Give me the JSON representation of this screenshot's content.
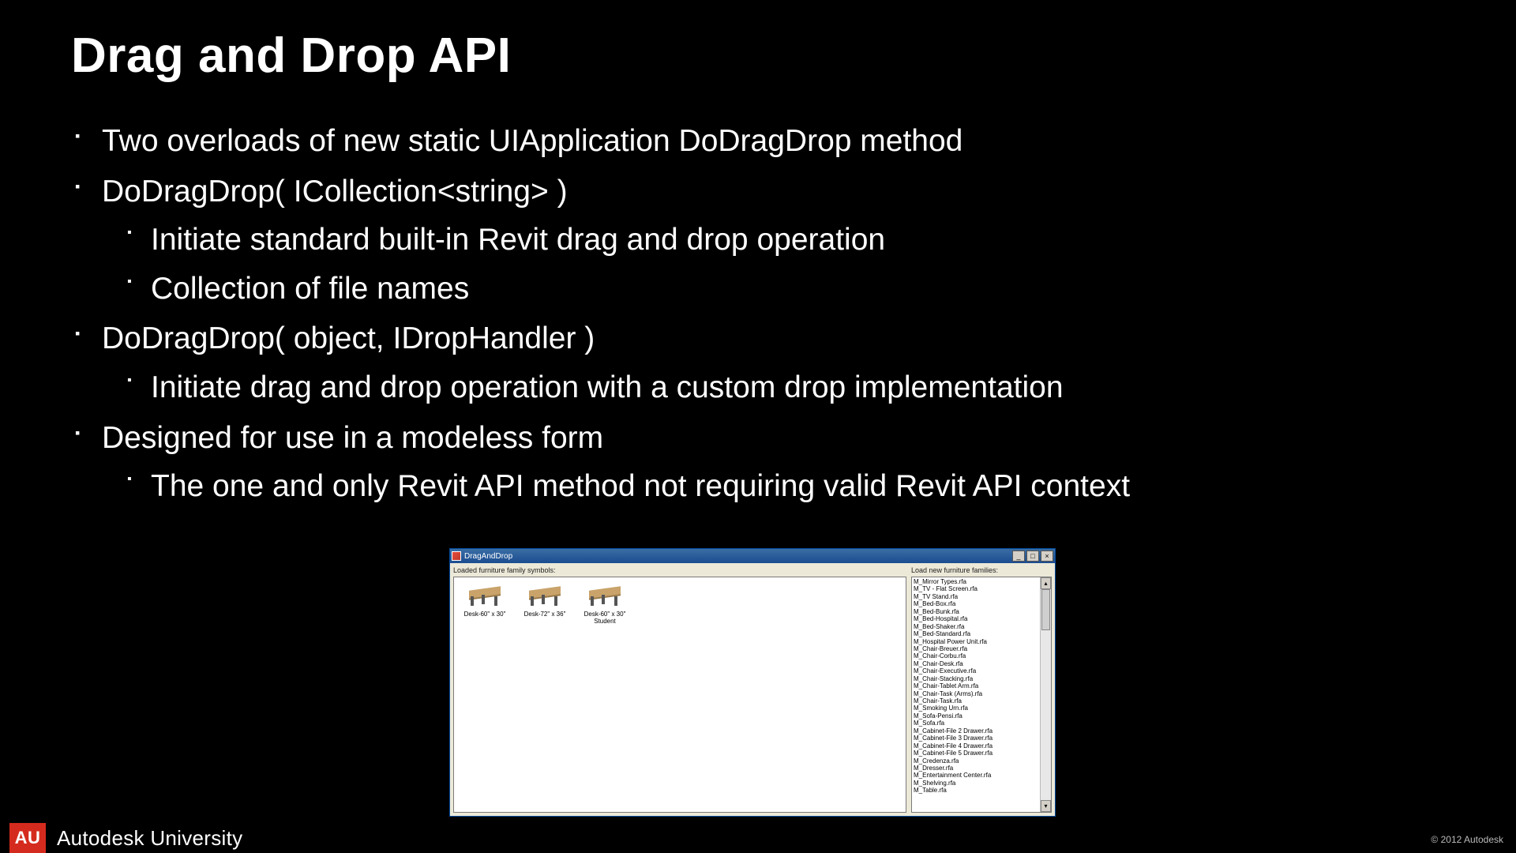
{
  "title": "Drag and Drop API",
  "bullets": {
    "b1": "Two overloads of new static UIApplication DoDragDrop method",
    "b2": "DoDragDrop( ICollection<string> )",
    "b2a": "Initiate standard built-in Revit drag and drop operation",
    "b2b": "Collection of file names",
    "b3": "DoDragDrop( object, IDropHandler )",
    "b3a": "Initiate drag and drop operation with a custom drop implementation",
    "b4": "Designed for use in a modeless form",
    "b4a": "The one and only Revit API method not requiring valid Revit API context"
  },
  "window": {
    "title": "DragAndDrop",
    "left_label": "Loaded furniture family symbols:",
    "right_label": "Load new furniture families:",
    "thumbs": [
      "Desk-60\" x 30\"",
      "Desk-72\" x 36\"",
      "Desk-60\" x 30\" Student"
    ],
    "list": [
      "M_Mirror Types.rfa",
      "M_TV - Flat Screen.rfa",
      "M_TV Stand.rfa",
      "M_Bed-Box.rfa",
      "M_Bed-Bunk.rfa",
      "M_Bed-Hospital.rfa",
      "M_Bed-Shaker.rfa",
      "M_Bed-Standard.rfa",
      "M_Hospital Power Unit.rfa",
      "M_Chair-Breuer.rfa",
      "M_Chair-Corbu.rfa",
      "M_Chair-Desk.rfa",
      "M_Chair-Executive.rfa",
      "M_Chair-Stacking.rfa",
      "M_Chair-Tablet Arm.rfa",
      "M_Chair-Task (Arms).rfa",
      "M_Chair-Task.rfa",
      "M_Smoking Urn.rfa",
      "M_Sofa-Pensi.rfa",
      "M_Sofa.rfa",
      "M_Cabinet-File 2 Drawer.rfa",
      "M_Cabinet-File 3 Drawer.rfa",
      "M_Cabinet-File 4 Drawer.rfa",
      "M_Cabinet-File 5 Drawer.rfa",
      "M_Credenza.rfa",
      "M_Dresser.rfa",
      "M_Entertainment Center.rfa",
      "M_Shelving.rfa",
      "M_Table.rfa"
    ]
  },
  "footer": {
    "badge": "AU",
    "brand": "Autodesk University",
    "copyright": "© 2012 Autodesk"
  }
}
